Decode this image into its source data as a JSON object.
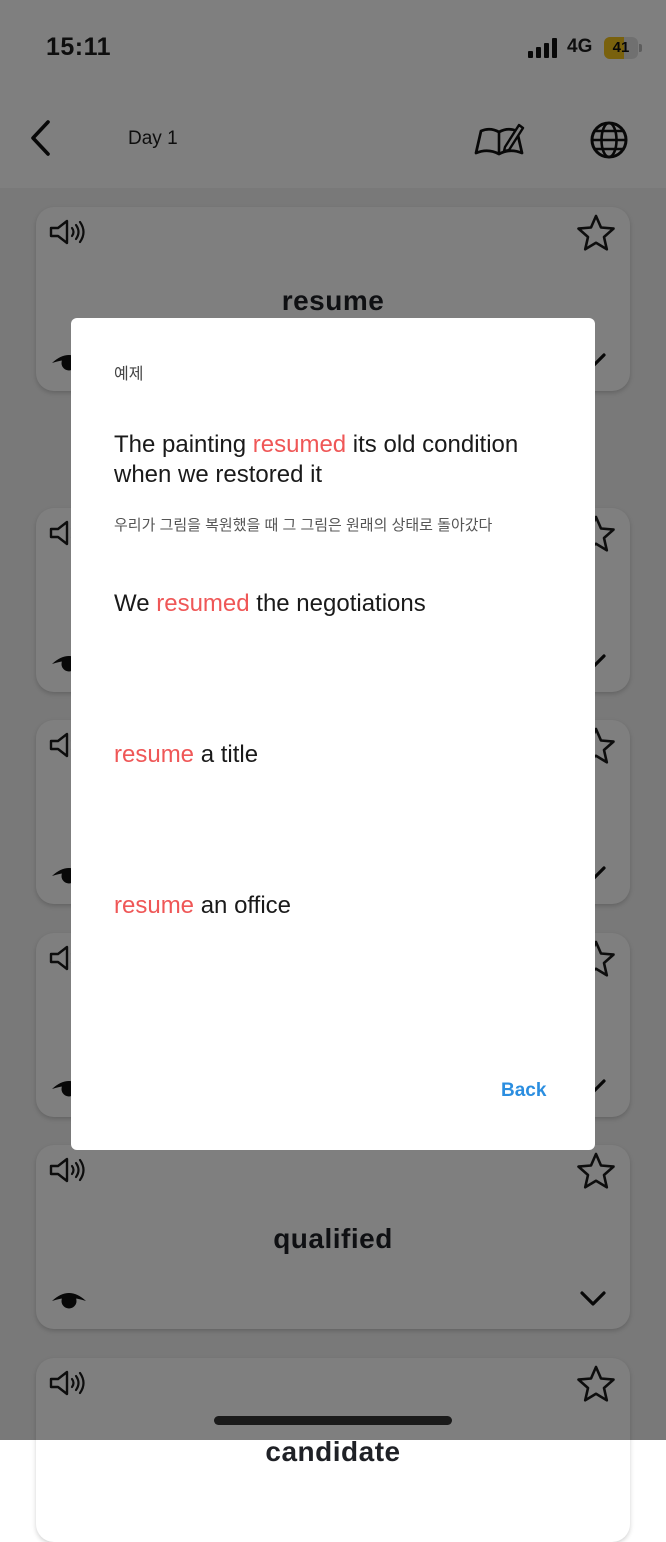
{
  "status_bar": {
    "time": "15:11",
    "network": "4G",
    "battery": "41"
  },
  "app_bar": {
    "title": "Day 1",
    "icons": [
      "back-arrow-icon",
      "book-edit-icon",
      "globe-icon"
    ]
  },
  "cards": [
    {
      "word": "resume"
    },
    {
      "word": ""
    },
    {
      "word": ""
    },
    {
      "word": ""
    },
    {
      "word": "qualified"
    },
    {
      "word": "candidate"
    }
  ],
  "dialog": {
    "title": "예제",
    "examples": [
      {
        "pre": "The painting ",
        "keyword": "resumed",
        "post": " its old condition when we restored it"
      },
      {
        "pre": "We ",
        "keyword": "resumed",
        "post": " the negotiations"
      },
      {
        "pre": "",
        "keyword": "resume",
        "post": " a title"
      },
      {
        "pre": "",
        "keyword": "resume",
        "post": " an office"
      }
    ],
    "translation": "우리가 그림을 복원했을 때 그 그림은 원래의 상태로 돌아갔다",
    "back_label": "Back"
  },
  "colors": {
    "highlight": "#ef5757",
    "link": "#2b8ee0",
    "scrim": "rgba(0,0,0,0.5)"
  }
}
